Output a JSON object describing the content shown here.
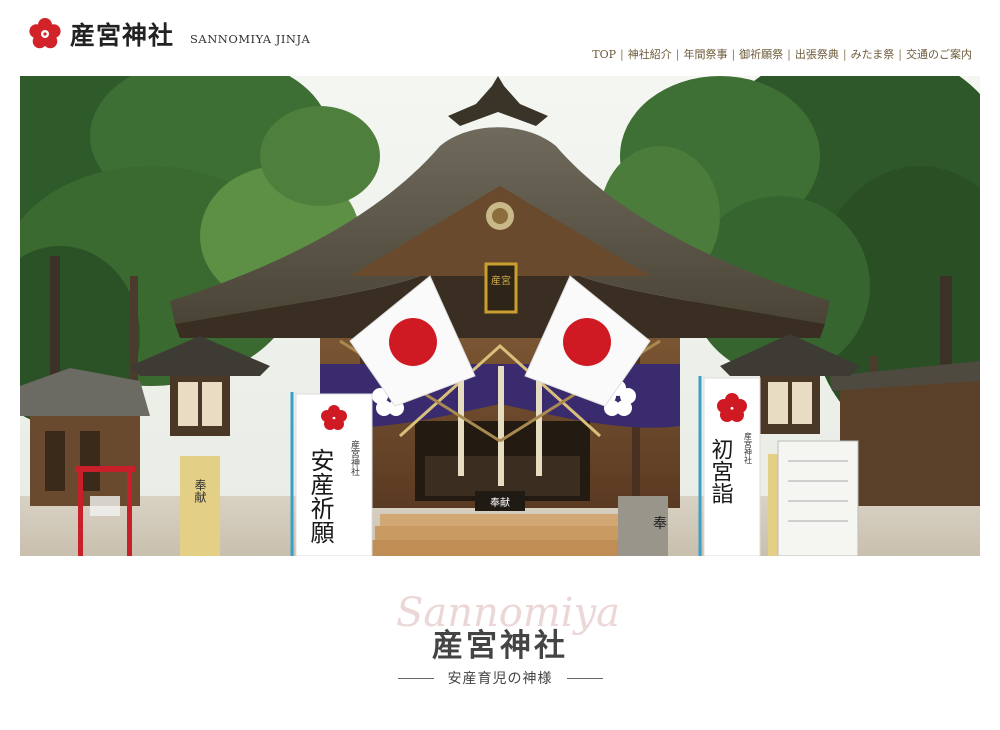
{
  "header": {
    "logo_jp": "産宮神社",
    "logo_en": "SANNOMIYA JINJA"
  },
  "nav": [
    {
      "label": "TOP"
    },
    {
      "label": "神社紹介"
    },
    {
      "label": "年間祭事"
    },
    {
      "label": "御祈願祭"
    },
    {
      "label": "出張祭典"
    },
    {
      "label": "みたま祭"
    },
    {
      "label": "交通のご案内"
    }
  ],
  "hero": {
    "shrine_plaque": "産宮",
    "banner_left": "安産祈願",
    "banner_left_small": "産宮神社",
    "banner_right": "初宮詣",
    "banner_right_small": "産宮神社",
    "lantern_base_left": "奉献",
    "offering_box": "奉献",
    "stone_post": "奉"
  },
  "title": {
    "script": "Sannomiya",
    "main": "産宮神社",
    "subtitle": "安産育児の神様"
  },
  "colors": {
    "accent": "#d2232a",
    "nav_text": "#6d5a3a",
    "purple_curtain": "#3a2a6e"
  }
}
